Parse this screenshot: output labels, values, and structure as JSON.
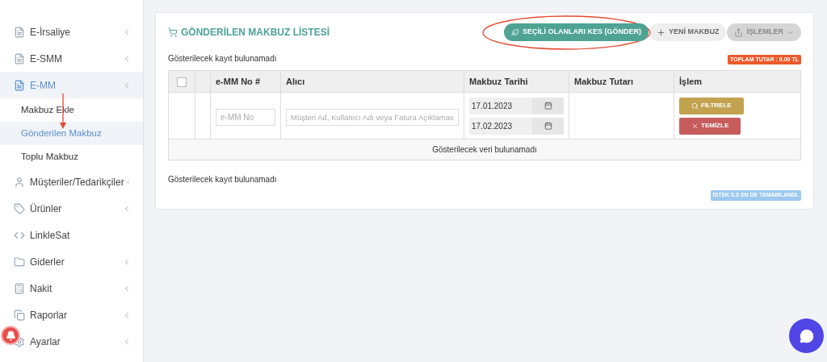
{
  "sidebar": {
    "items": [
      {
        "label": "E-İrsaliye",
        "selected": false,
        "has_submenu": true
      },
      {
        "label": "E-SMM",
        "selected": false,
        "has_submenu": true
      },
      {
        "label": "E-MM",
        "selected": true,
        "has_submenu": true,
        "children": [
          {
            "label": "Makbuz Ekle",
            "selected": false
          },
          {
            "label": "Gönderilen Makbuz",
            "selected": true
          },
          {
            "label": "Toplu Makbuz",
            "selected": false
          }
        ]
      },
      {
        "label": "Müşteriler/Tedarikçiler",
        "selected": false,
        "has_submenu": true
      },
      {
        "label": "Ürünler",
        "selected": false,
        "has_submenu": true
      },
      {
        "label": "LinkleSat",
        "selected": false,
        "has_submenu": false
      },
      {
        "label": "Giderler",
        "selected": false,
        "has_submenu": true
      },
      {
        "label": "Nakit",
        "selected": false,
        "has_submenu": true
      },
      {
        "label": "Raporlar",
        "selected": false,
        "has_submenu": true
      },
      {
        "label": "Ayarlar",
        "selected": false,
        "has_submenu": true
      }
    ]
  },
  "panel": {
    "title": "GÖNDERİLEN MAKBUZ LİSTESİ",
    "buttons": [
      {
        "label": "SEÇİLİ OLANLARI KES (GÖNDER)",
        "kind": "primary"
      },
      {
        "label": "YENİ MAKBUZ",
        "kind": "plain"
      },
      {
        "label": "İŞLEMLER",
        "kind": "dropdown"
      }
    ],
    "record_info_top": "Gösterilecek kayıt bulunamadı",
    "total_badge": "TOPLAM TUTAR : 0.00 TL",
    "table": {
      "columns": [
        "e-MM No #",
        "Alıcı",
        "Makbuz Tarihi",
        "Makbuz Tutarı",
        "İşlem"
      ],
      "select_all_checked": false,
      "filters": {
        "number_placeholder": "e-MM No",
        "recipient_placeholder": "Müşteri Ad, Kullanıcı Adı veya Fatura Açıklamas",
        "date_from": "17.01.2023",
        "date_to": "17.02.2023",
        "filter_button": "FİLTRELE",
        "clear_button": "TEMİZLE"
      },
      "empty_message": "Gösterilecek veri bulunamadı"
    },
    "record_info_bottom": "Gösterilecek kayıt bulunamadı",
    "timing_badge": "İSTEK 0.3 SN DE TAMAMLANDI."
  }
}
